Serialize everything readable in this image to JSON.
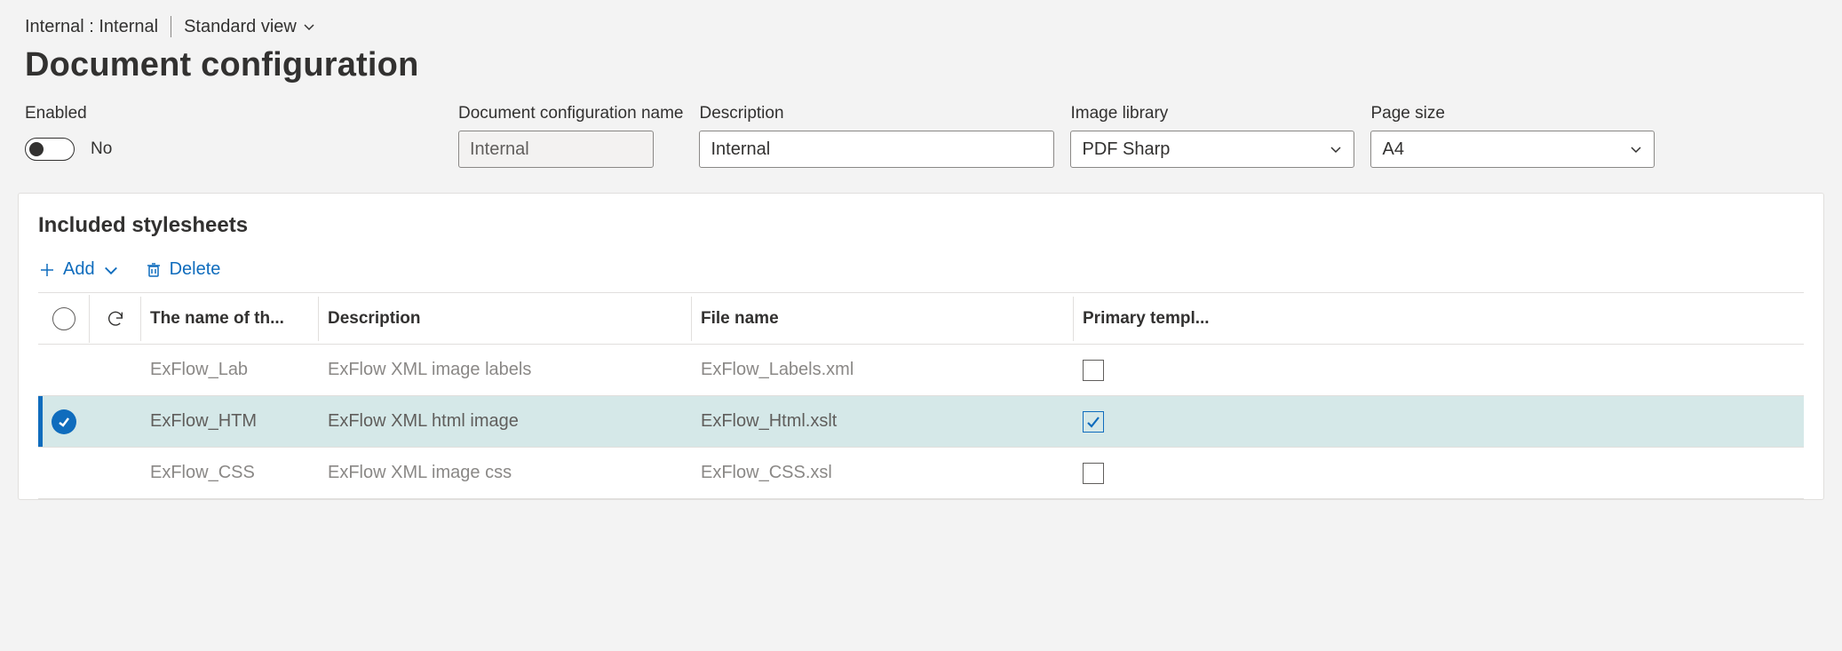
{
  "breadcrumb": "Internal : Internal",
  "view_switcher": {
    "label": "Standard view"
  },
  "page_title": "Document configuration",
  "fields": {
    "enabled": {
      "label": "Enabled",
      "value_text": "No"
    },
    "config_name": {
      "label": "Document configuration name",
      "value": "Internal"
    },
    "description": {
      "label": "Description",
      "value": "Internal"
    },
    "image_library": {
      "label": "Image library",
      "value": "PDF Sharp"
    },
    "page_size": {
      "label": "Page size",
      "value": "A4"
    }
  },
  "stylesheets_panel": {
    "title": "Included stylesheets",
    "toolbar": {
      "add": "Add",
      "delete": "Delete"
    },
    "columns": {
      "name": "The name of th...",
      "description": "Description",
      "file_name": "File name",
      "primary": "Primary templ..."
    },
    "rows": [
      {
        "selected": false,
        "name": "ExFlow_Lab",
        "description": "ExFlow XML image labels",
        "file_name": "ExFlow_Labels.xml",
        "primary": false
      },
      {
        "selected": true,
        "name": "ExFlow_HTM",
        "description": "ExFlow XML html image",
        "file_name": "ExFlow_Html.xslt",
        "primary": true
      },
      {
        "selected": false,
        "name": "ExFlow_CSS",
        "description": "ExFlow XML image css",
        "file_name": "ExFlow_CSS.xsl",
        "primary": false
      }
    ]
  }
}
